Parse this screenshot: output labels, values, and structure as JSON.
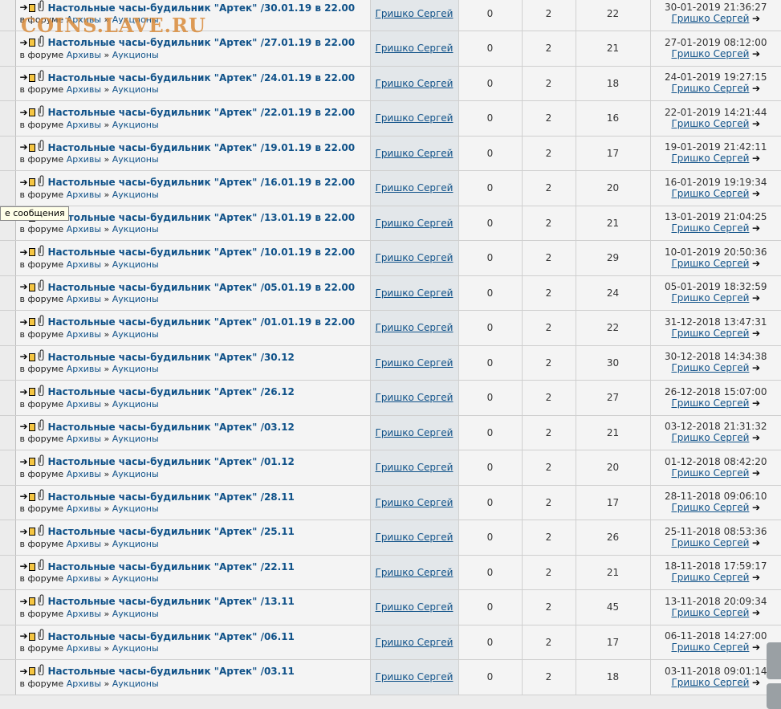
{
  "watermark": "COINS.LAVE.RU",
  "tooltip": "е сообщения",
  "labels": {
    "in_forum": "в форуме",
    "sep": "»",
    "arrow_icon": "➔",
    "last_post_icon": "➔"
  },
  "topics": [
    {
      "title": "Настольные часы-будильник \"Артек\" /30.01.19 в 22.00",
      "forum": "Архивы",
      "subforum": "Аукционы",
      "author": "Гришко Сергей",
      "replies": "0",
      "col4": "2",
      "views": "22",
      "last_date": "30-01-2019 21:36:27",
      "last_by": "Гришко Сергей"
    },
    {
      "title": "Настольные часы-будильник \"Артек\" /27.01.19 в 22.00",
      "forum": "Архивы",
      "subforum": "Аукционы",
      "author": "Гришко Сергей",
      "replies": "0",
      "col4": "2",
      "views": "21",
      "last_date": "27-01-2019 08:12:00",
      "last_by": "Гришко Сергей"
    },
    {
      "title": "Настольные часы-будильник \"Артек\" /24.01.19 в 22.00",
      "forum": "Архивы",
      "subforum": "Аукционы",
      "author": "Гришко Сергей",
      "replies": "0",
      "col4": "2",
      "views": "18",
      "last_date": "24-01-2019 19:27:15",
      "last_by": "Гришко Сергей"
    },
    {
      "title": "Настольные часы-будильник \"Артек\" /22.01.19 в 22.00",
      "forum": "Архивы",
      "subforum": "Аукционы",
      "author": "Гришко Сергей",
      "replies": "0",
      "col4": "2",
      "views": "16",
      "last_date": "22-01-2019 14:21:44",
      "last_by": "Гришко Сергей"
    },
    {
      "title": "Настольные часы-будильник \"Артек\" /19.01.19 в 22.00",
      "forum": "Архивы",
      "subforum": "Аукционы",
      "author": "Гришко Сергей",
      "replies": "0",
      "col4": "2",
      "views": "17",
      "last_date": "19-01-2019 21:42:11",
      "last_by": "Гришко Сергей"
    },
    {
      "title": "Настольные часы-будильник \"Артек\" /16.01.19 в 22.00",
      "forum": "Архивы",
      "subforum": "Аукционы",
      "author": "Гришко Сергей",
      "replies": "0",
      "col4": "2",
      "views": "20",
      "last_date": "16-01-2019 19:19:34",
      "last_by": "Гришко Сергей"
    },
    {
      "title": "Настольные часы-будильник \"Артек\" /13.01.19 в 22.00",
      "forum": "Архивы",
      "subforum": "Аукционы",
      "author": "Гришко Сергей",
      "replies": "0",
      "col4": "2",
      "views": "21",
      "last_date": "13-01-2019 21:04:25",
      "last_by": "Гришко Сергей"
    },
    {
      "title": "Настольные часы-будильник \"Артек\" /10.01.19 в 22.00",
      "forum": "Архивы",
      "subforum": "Аукционы",
      "author": "Гришко Сергей",
      "replies": "0",
      "col4": "2",
      "views": "29",
      "last_date": "10-01-2019 20:50:36",
      "last_by": "Гришко Сергей"
    },
    {
      "title": "Настольные часы-будильник \"Артек\" /05.01.19 в 22.00",
      "forum": "Архивы",
      "subforum": "Аукционы",
      "author": "Гришко Сергей",
      "replies": "0",
      "col4": "2",
      "views": "24",
      "last_date": "05-01-2019 18:32:59",
      "last_by": "Гришко Сергей"
    },
    {
      "title": "Настольные часы-будильник \"Артек\" /01.01.19 в 22.00",
      "forum": "Архивы",
      "subforum": "Аукционы",
      "author": "Гришко Сергей",
      "replies": "0",
      "col4": "2",
      "views": "22",
      "last_date": "31-12-2018 13:47:31",
      "last_by": "Гришко Сергей"
    },
    {
      "title": "Настольные часы-будильник \"Артек\" /30.12",
      "forum": "Архивы",
      "subforum": "Аукционы",
      "author": "Гришко Сергей",
      "replies": "0",
      "col4": "2",
      "views": "30",
      "last_date": "30-12-2018 14:34:38",
      "last_by": "Гришко Сергей"
    },
    {
      "title": "Настольные часы-будильник \"Артек\" /26.12",
      "forum": "Архивы",
      "subforum": "Аукционы",
      "author": "Гришко Сергей",
      "replies": "0",
      "col4": "2",
      "views": "27",
      "last_date": "26-12-2018 15:07:00",
      "last_by": "Гришко Сергей"
    },
    {
      "title": "Настольные часы-будильник \"Артек\" /03.12",
      "forum": "Архивы",
      "subforum": "Аукционы",
      "author": "Гришко Сергей",
      "replies": "0",
      "col4": "2",
      "views": "21",
      "last_date": "03-12-2018 21:31:32",
      "last_by": "Гришко Сергей"
    },
    {
      "title": "Настольные часы-будильник \"Артек\" /01.12",
      "forum": "Архивы",
      "subforum": "Аукционы",
      "author": "Гришко Сергей",
      "replies": "0",
      "col4": "2",
      "views": "20",
      "last_date": "01-12-2018 08:42:20",
      "last_by": "Гришко Сергей"
    },
    {
      "title": "Настольные часы-будильник \"Артек\" /28.11",
      "forum": "Архивы",
      "subforum": "Аукционы",
      "author": "Гришко Сергей",
      "replies": "0",
      "col4": "2",
      "views": "17",
      "last_date": "28-11-2018 09:06:10",
      "last_by": "Гришко Сергей"
    },
    {
      "title": "Настольные часы-будильник \"Артек\" /25.11",
      "forum": "Архивы",
      "subforum": "Аукционы",
      "author": "Гришко Сергей",
      "replies": "0",
      "col4": "2",
      "views": "26",
      "last_date": "25-11-2018 08:53:36",
      "last_by": "Гришко Сергей"
    },
    {
      "title": "Настольные часы-будильник \"Артек\" /22.11",
      "forum": "Архивы",
      "subforum": "Аукционы",
      "author": "Гришко Сергей",
      "replies": "0",
      "col4": "2",
      "views": "21",
      "last_date": "18-11-2018 17:59:17",
      "last_by": "Гришко Сергей"
    },
    {
      "title": "Настольные часы-будильник \"Артек\" /13.11",
      "forum": "Архивы",
      "subforum": "Аукционы",
      "author": "Гришко Сергей",
      "replies": "0",
      "col4": "2",
      "views": "45",
      "last_date": "13-11-2018 20:09:34",
      "last_by": "Гришко Сергей"
    },
    {
      "title": "Настольные часы-будильник \"Артек\" /06.11",
      "forum": "Архивы",
      "subforum": "Аукционы",
      "author": "Гришко Сергей",
      "replies": "0",
      "col4": "2",
      "views": "17",
      "last_date": "06-11-2018 14:27:00",
      "last_by": "Гришко Сергей"
    },
    {
      "title": "Настольные часы-будильник \"Артек\" /03.11",
      "forum": "Архивы",
      "subforum": "Аукционы",
      "author": "Гришко Сергей",
      "replies": "0",
      "col4": "2",
      "views": "18",
      "last_date": "03-11-2018 09:01:14",
      "last_by": "Гришко Сергей"
    }
  ]
}
